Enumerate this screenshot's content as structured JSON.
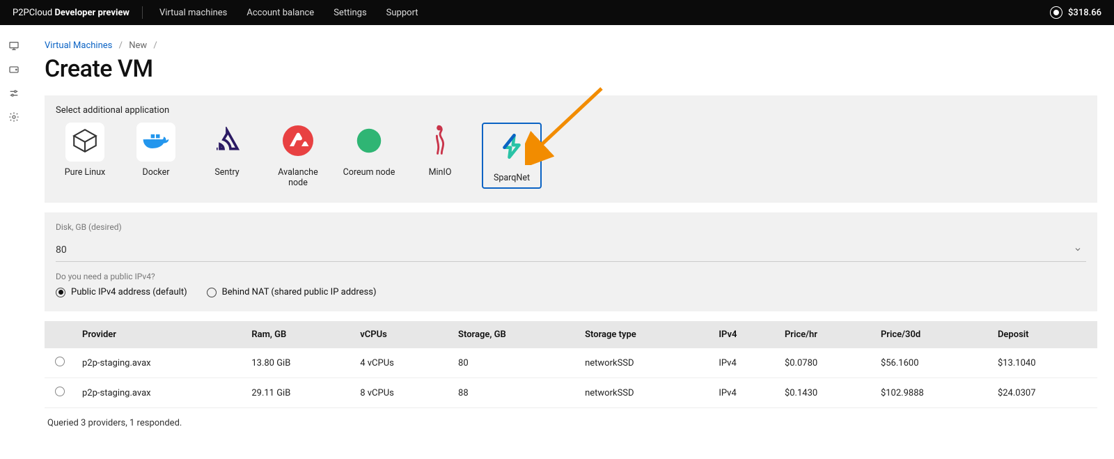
{
  "topbar": {
    "brand_prefix": "P2PCloud ",
    "brand_bold": "Developer preview",
    "nav": [
      {
        "label": "Virtual machines"
      },
      {
        "label": "Account balance"
      },
      {
        "label": "Settings"
      },
      {
        "label": "Support"
      }
    ],
    "balance": "$318.66"
  },
  "breadcrumb": {
    "root": "Virtual Machines",
    "leaf": "New"
  },
  "page_title": "Create VM",
  "apps_panel": {
    "label": "Select additional application",
    "items": [
      {
        "label": "Pure Linux",
        "icon": "box-icon",
        "selected": false
      },
      {
        "label": "Docker",
        "icon": "docker-icon",
        "selected": false
      },
      {
        "label": "Sentry",
        "icon": "sentry-icon",
        "selected": false
      },
      {
        "label": "Avalanche node",
        "icon": "avalanche-icon",
        "selected": false
      },
      {
        "label": "Coreum node",
        "icon": "coreum-icon",
        "selected": false
      },
      {
        "label": "MinIO",
        "icon": "minio-icon",
        "selected": false
      },
      {
        "label": "SparqNet",
        "icon": "sparqnet-icon",
        "selected": true
      }
    ]
  },
  "disk": {
    "label": "Disk, GB (desired)",
    "value": "80"
  },
  "ipv4": {
    "question": "Do you need a public IPv4?",
    "options": [
      {
        "label": "Public IPv4 address (default)",
        "checked": true
      },
      {
        "label": "Behind NAT (shared public IP address)",
        "checked": false
      }
    ]
  },
  "table": {
    "headers": {
      "provider": "Provider",
      "ram": "Ram, GB",
      "vcpus": "vCPUs",
      "storage": "Storage, GB",
      "storage_type": "Storage type",
      "ipv4": "IPv4",
      "price_hr": "Price/hr",
      "price_30d": "Price/30d",
      "deposit": "Deposit"
    },
    "rows": [
      {
        "provider": "p2p-staging.avax",
        "ram": "13.80 GiB",
        "vcpus": "4 vCPUs",
        "storage": "80",
        "storage_type": "networkSSD",
        "ipv4": "IPv4",
        "price_hr": "$0.0780",
        "price_30d": "$56.1600",
        "deposit": "$13.1040"
      },
      {
        "provider": "p2p-staging.avax",
        "ram": "29.11 GiB",
        "vcpus": "8 vCPUs",
        "storage": "88",
        "storage_type": "networkSSD",
        "ipv4": "IPv4",
        "price_hr": "$0.1430",
        "price_30d": "$102.9888",
        "deposit": "$24.0307"
      }
    ],
    "footer": "Queried 3 providers, 1 responded."
  }
}
